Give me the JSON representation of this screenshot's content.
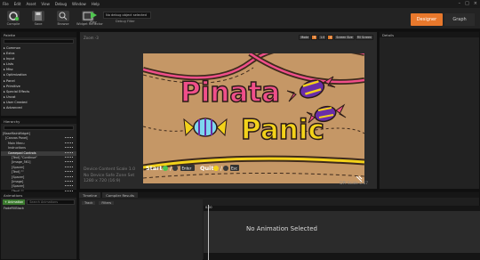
{
  "menu": [
    "File",
    "Edit",
    "Asset",
    "View",
    "Debug",
    "Window",
    "Help"
  ],
  "user": "User Widget",
  "toolbar": {
    "compile": "Compile",
    "save": "Save",
    "browse": "Browse",
    "parent": "Widget Reflector",
    "play": "Play",
    "debug_value": "No debug object selected",
    "debug_filter": "Debug Filter"
  },
  "modes": {
    "designer": "Designer",
    "graph": "Graph"
  },
  "palette": {
    "title": "Palette",
    "categories": [
      "Common",
      "Extra",
      "Input",
      "Lists",
      "Misc",
      "Optimization",
      "Panel",
      "Primitive",
      "Special Effects",
      "Uncat",
      "User Created",
      "Advanced"
    ]
  },
  "hierarchy": {
    "title": "Hierarchy",
    "items": [
      "[BaseMainWidget]",
      "[Canvas Panel]",
      "Main Menu",
      "Instructions",
      "Gamepad Controls",
      "[Text] \"Continue\"",
      "[Image_561]",
      "[Spacer]",
      "[Text] \"\"",
      "[Spacer]",
      "[Image]",
      "[Spacer]",
      "[Text] \"\"",
      "[Spacer]",
      "[Text] \"Enter\"",
      "[Textblock_1070] \"B R E A T H E\""
    ]
  },
  "designer": {
    "zoom": "Zoom -3",
    "tools": [
      "Mode",
      "R",
      "1.0",
      "4",
      "Screen Size",
      "Fill Screen"
    ],
    "info": [
      "Device Content Scale 1.0",
      "No Device Safe Zone Set",
      "1280 x 720 (16:9)"
    ],
    "dpi": "DPI Scale 0.67"
  },
  "details": {
    "title": "Details"
  },
  "game_screen": {
    "title_line1": "Pinata",
    "title_line2": "Panic",
    "start_label": "Start:",
    "quit_label": "Quit:",
    "enter_key": "Enter",
    "esc_key": "Esc"
  },
  "animations": {
    "title": "Animations",
    "add": "+ Animation",
    "search": "Search Animations",
    "first": "FadeFillBlack"
  },
  "timeline": {
    "tabs": [
      "Timeline",
      "Compiler Results"
    ],
    "track": "Track",
    "filters": "Filters",
    "empty": "No Animation Selected",
    "time": "0.00"
  },
  "colors": {
    "accent": "#e8782c",
    "canvas_bg": "#c59766",
    "pink": "#f04f8a",
    "purple": "#6a2ea8",
    "yellow": "#f3d21a",
    "blue": "#7ed6ee"
  }
}
